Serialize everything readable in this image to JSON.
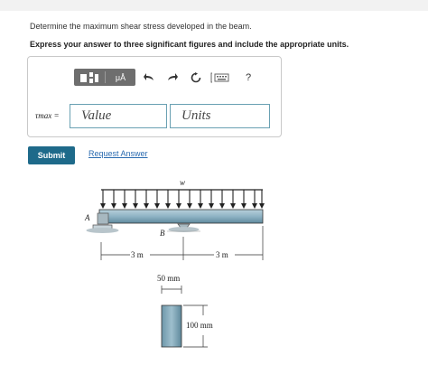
{
  "question": {
    "prompt": "Determine the maximum shear stress developed in the beam.",
    "instruction": "Express your answer to three significant figures and include the appropriate units."
  },
  "toolbar": {
    "templates_icon": "templates-icon",
    "mu_label": "μÅ",
    "undo_icon": "undo-icon",
    "redo_icon": "redo-icon",
    "reset_icon": "reset-icon",
    "keyboard_icon": "keyboard-icon",
    "help_label": "?"
  },
  "answer": {
    "variable_label": "τmax =",
    "value_placeholder": "Value",
    "units_placeholder": "Units"
  },
  "actions": {
    "submit_label": "Submit",
    "request_answer_label": "Request Answer"
  },
  "figure": {
    "load_label": "w",
    "support_a_label": "A",
    "support_b_label": "B",
    "span_1_label": "3 m",
    "span_2_label": "3 m",
    "width_label": "50 mm",
    "height_label": "100 mm"
  },
  "colors": {
    "button_primary": "#1e6a8a",
    "link": "#2a6bb0",
    "field_border": "#6aa1b3",
    "beam_fill": "#8fb3c4"
  }
}
